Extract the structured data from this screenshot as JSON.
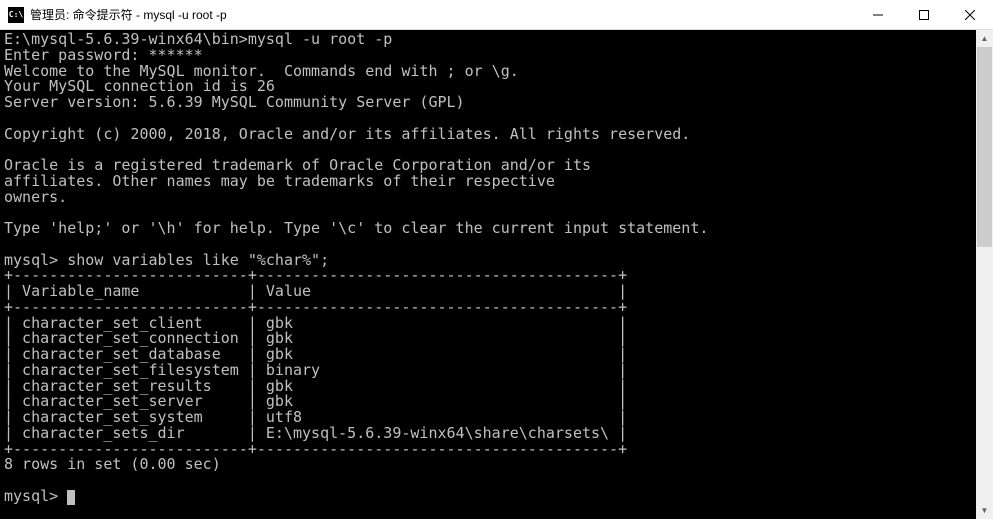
{
  "titlebar": {
    "icon_text": "C:\\",
    "title": "管理员: 命令提示符 - mysql  -u root -p"
  },
  "terminal": {
    "prompt_line": "E:\\mysql-5.6.39-winx64\\bin>mysql -u root -p",
    "password_line": "Enter password: ******",
    "welcome_line": "Welcome to the MySQL monitor.  Commands end with ; or \\g.",
    "connection_line": "Your MySQL connection id is 26",
    "version_line": "Server version: 5.6.39 MySQL Community Server (GPL)",
    "copyright_line": "Copyright (c) 2000, 2018, Oracle and/or its affiliates. All rights reserved.",
    "trademark_line1": "Oracle is a registered trademark of Oracle Corporation and/or its",
    "trademark_line2": "affiliates. Other names may be trademarks of their respective",
    "trademark_line3": "owners.",
    "help_line": "Type 'help;' or '\\h' for help. Type '\\c' to clear the current input statement.",
    "query_prompt": "mysql> show variables like \"%char%\";",
    "table_border_top": "+--------------------------+----------------------------------------+",
    "table_header": "| Variable_name            | Value                                  |",
    "table_border_mid": "+--------------------------+----------------------------------------+",
    "rows": [
      "| character_set_client     | gbk                                    |",
      "| character_set_connection | gbk                                    |",
      "| character_set_database   | gbk                                    |",
      "| character_set_filesystem | binary                                 |",
      "| character_set_results    | gbk                                    |",
      "| character_set_server     | gbk                                    |",
      "| character_set_system     | utf8                                   |",
      "| character_sets_dir       | E:\\mysql-5.6.39-winx64\\share\\charsets\\ |"
    ],
    "table_border_bot": "+--------------------------+----------------------------------------+",
    "result_line": "8 rows in set (0.00 sec)",
    "final_prompt": "mysql> "
  },
  "chart_data": {
    "type": "table",
    "title": "show variables like \"%char%\"",
    "columns": [
      "Variable_name",
      "Value"
    ],
    "data": [
      [
        "character_set_client",
        "gbk"
      ],
      [
        "character_set_connection",
        "gbk"
      ],
      [
        "character_set_database",
        "gbk"
      ],
      [
        "character_set_filesystem",
        "binary"
      ],
      [
        "character_set_results",
        "gbk"
      ],
      [
        "character_set_server",
        "gbk"
      ],
      [
        "character_set_system",
        "utf8"
      ],
      [
        "character_sets_dir",
        "E:\\mysql-5.6.39-winx64\\share\\charsets\\"
      ]
    ],
    "row_count": 8,
    "elapsed": "0.00 sec"
  }
}
